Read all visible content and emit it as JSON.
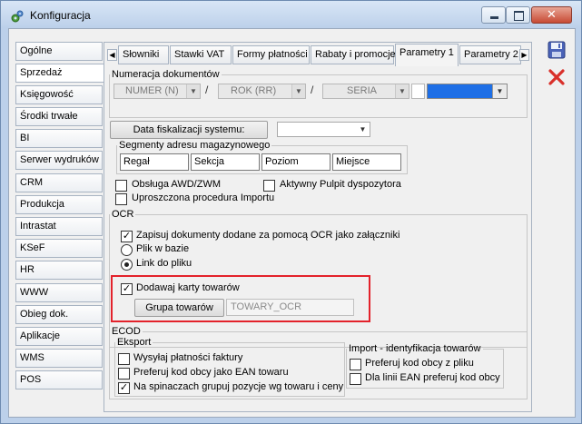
{
  "window": {
    "title": "Konfiguracja",
    "minimize_label": "–",
    "maximize_label": "□",
    "close_label": "✕"
  },
  "nav": {
    "items": [
      {
        "label": "Ogólne"
      },
      {
        "label": "Sprzedaż"
      },
      {
        "label": "Księgowość"
      },
      {
        "label": "Środki trwałe"
      },
      {
        "label": "BI"
      },
      {
        "label": "Serwer wydruków"
      },
      {
        "label": "CRM"
      },
      {
        "label": "Produkcja"
      },
      {
        "label": "Intrastat"
      },
      {
        "label": "KSeF"
      },
      {
        "label": "HR"
      },
      {
        "label": "WWW"
      },
      {
        "label": "Obieg dok."
      },
      {
        "label": "Aplikacje"
      },
      {
        "label": "WMS"
      },
      {
        "label": "POS"
      }
    ],
    "active_index": 1
  },
  "tabs": {
    "left_arrow": "◀",
    "right_arrow": "▶",
    "items": [
      {
        "label": "Słowniki"
      },
      {
        "label": "Stawki VAT"
      },
      {
        "label": "Formy płatności"
      },
      {
        "label": "Rabaty i promocje"
      },
      {
        "label": "Parametry 1"
      },
      {
        "label": "Parametry 2"
      }
    ],
    "active_index": 4
  },
  "numeracja": {
    "legend": "Numeracja dokumentów",
    "seg1": "NUMER (N)",
    "seg2": "ROK (RR)",
    "seg3": "SERIA",
    "separator": "/",
    "arrow": "▼"
  },
  "fiskalizacja": {
    "button": "Data fiskalizacji systemu:",
    "value": "",
    "arrow": "▼"
  },
  "segmenty": {
    "legend": "Segmenty adresu magazynowego",
    "cells": [
      "Regał",
      "Sekcja",
      "Poziom",
      "Miejsce"
    ]
  },
  "options": {
    "awd": {
      "label": "Obsługa AWD/ZWM",
      "checked": false
    },
    "pulpit": {
      "label": "Aktywny Pulpit dyspozytora",
      "checked": false
    },
    "import": {
      "label": "Uproszczona procedura Importu",
      "checked": false
    }
  },
  "ocr": {
    "legend": "OCR",
    "save_label": "Zapisuj dokumenty dodane za pomocą OCR jako załączniki",
    "save_checked": true,
    "file_in_db": "Plik w bazie",
    "link": "Link do pliku",
    "selected": "Link do pliku",
    "add_cards_label": "Dodawaj karty towarów",
    "add_cards_checked": true,
    "group_button": "Grupa towarów",
    "group_value": "TOWARY_OCR",
    "check_mark": "✓"
  },
  "ecod": {
    "legend": "ECOD",
    "eksport": {
      "legend": "Eksport",
      "items": [
        {
          "label": "Wysyłaj płatności faktury",
          "checked": false
        },
        {
          "label": "Preferuj kod obcy jako EAN towaru",
          "checked": false
        },
        {
          "label": "Na spinaczach grupuj pozycje wg towaru i ceny",
          "checked": true
        }
      ]
    },
    "import": {
      "legend": "Import - identyfikacja towarów",
      "items": [
        {
          "label": "Preferuj kod obcy z pliku",
          "checked": false
        },
        {
          "label": "Dla linii EAN preferuj kod obcy",
          "checked": false
        }
      ]
    }
  },
  "side": {
    "save_icon": "save-icon",
    "cancel_icon": "cancel-icon"
  },
  "colors": {
    "highlight": "#e3222b",
    "accent_blue": "#1e6fe6"
  }
}
